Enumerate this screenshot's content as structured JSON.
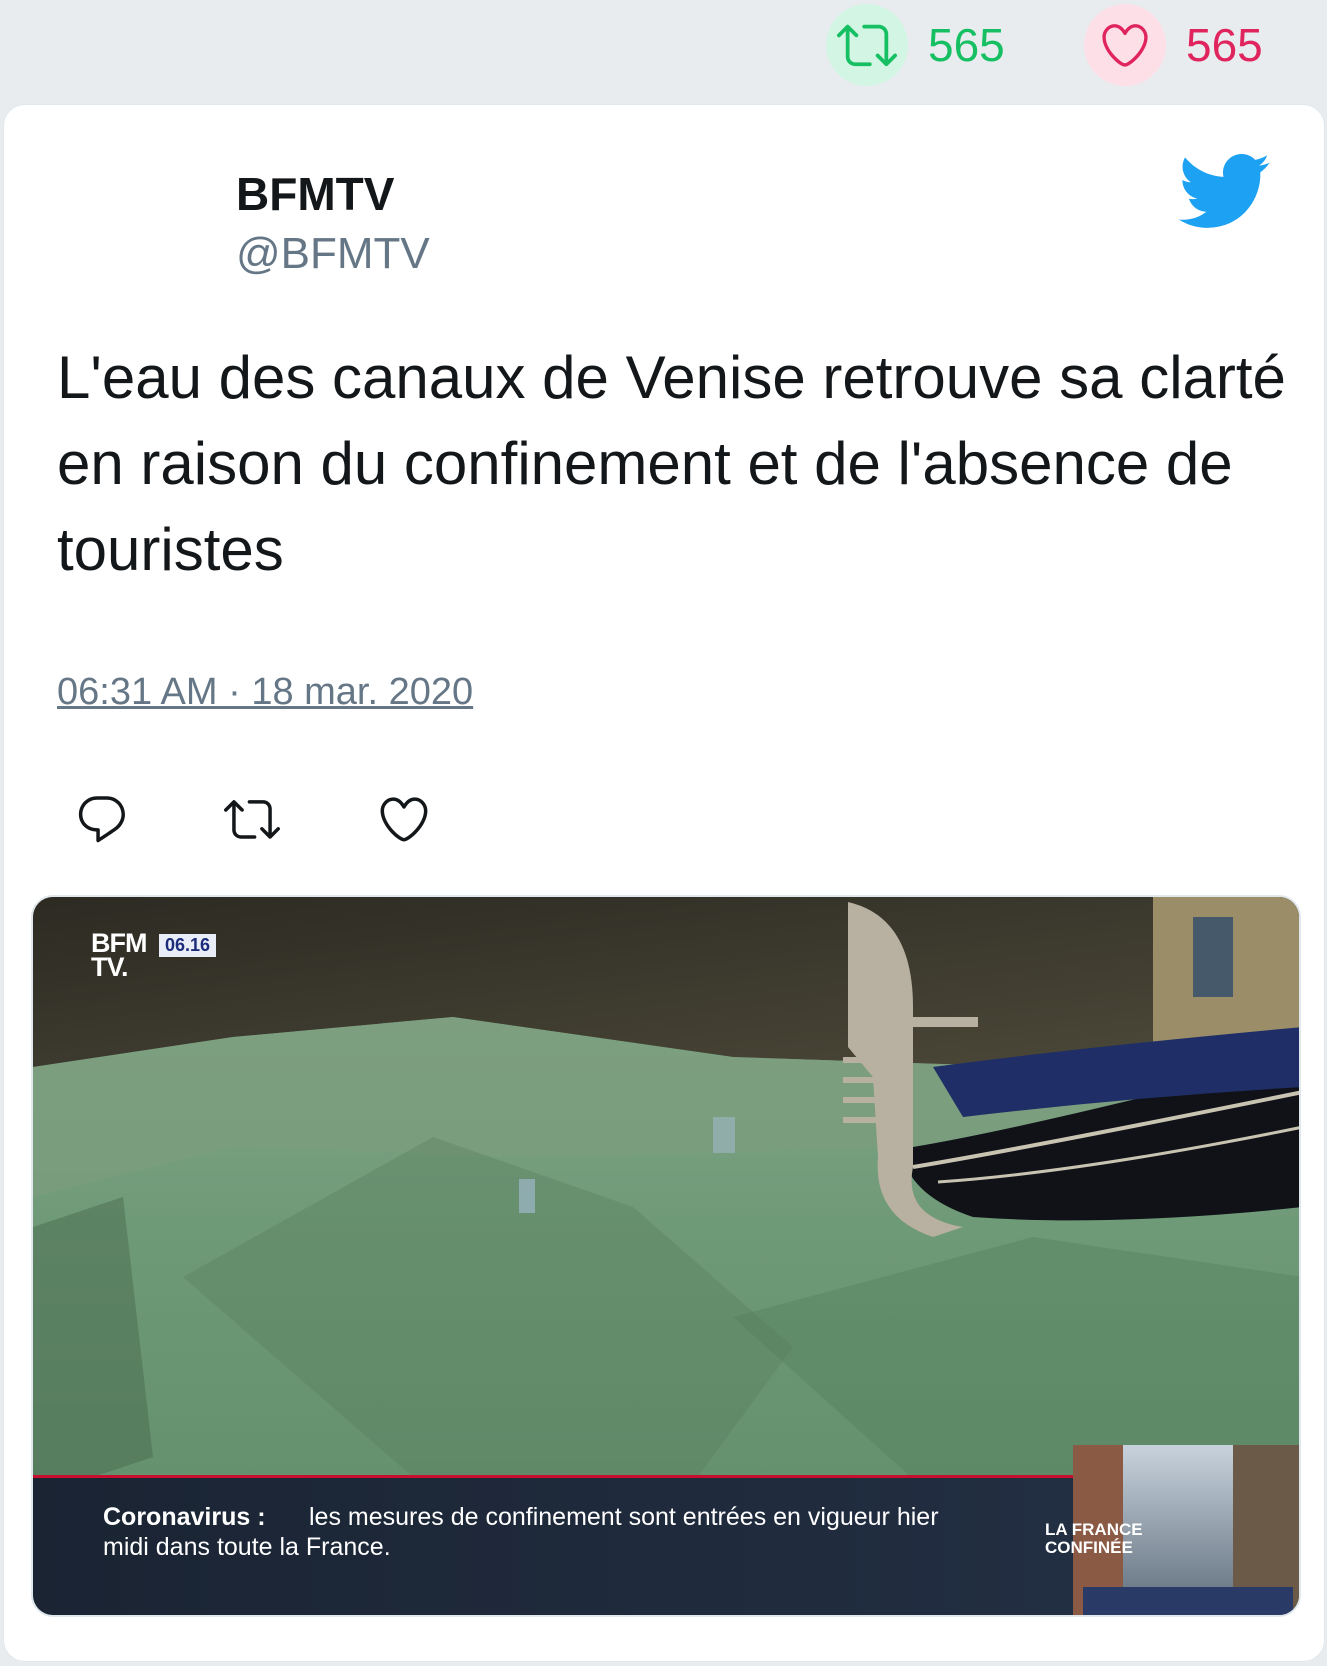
{
  "stats": {
    "retweets": "565",
    "likes": "565",
    "retweet_icon": "retweet-icon",
    "like_icon": "heart-icon"
  },
  "tweet": {
    "author_name": "BFMTV",
    "author_handle": "@BFMTV",
    "text": "L'eau des canaux de Venise retrouve sa clarté en raison du confinement et de l'absence de touristes",
    "timestamp": "06:31 AM · 18 mar. 2020",
    "actions": [
      "reply-icon",
      "retweet-icon",
      "heart-icon"
    ]
  },
  "media": {
    "logo_line1": "BFM",
    "logo_line2": "TV.",
    "logo_time": "06.16",
    "ticker_headline": "Coronavirus :",
    "ticker_line1": "les mesures de confinement sont entrées en vigueur hier",
    "ticker_line2": "midi dans toute la France.",
    "inset_line1": "LA FRANCE",
    "inset_line2": "CONFINÉE"
  },
  "colors": {
    "retweet": "#17bf63",
    "like": "#e0245e",
    "twitter_blue": "#1da1f2",
    "text": "#14171a",
    "muted": "#657786",
    "background": "#e8ecef"
  }
}
